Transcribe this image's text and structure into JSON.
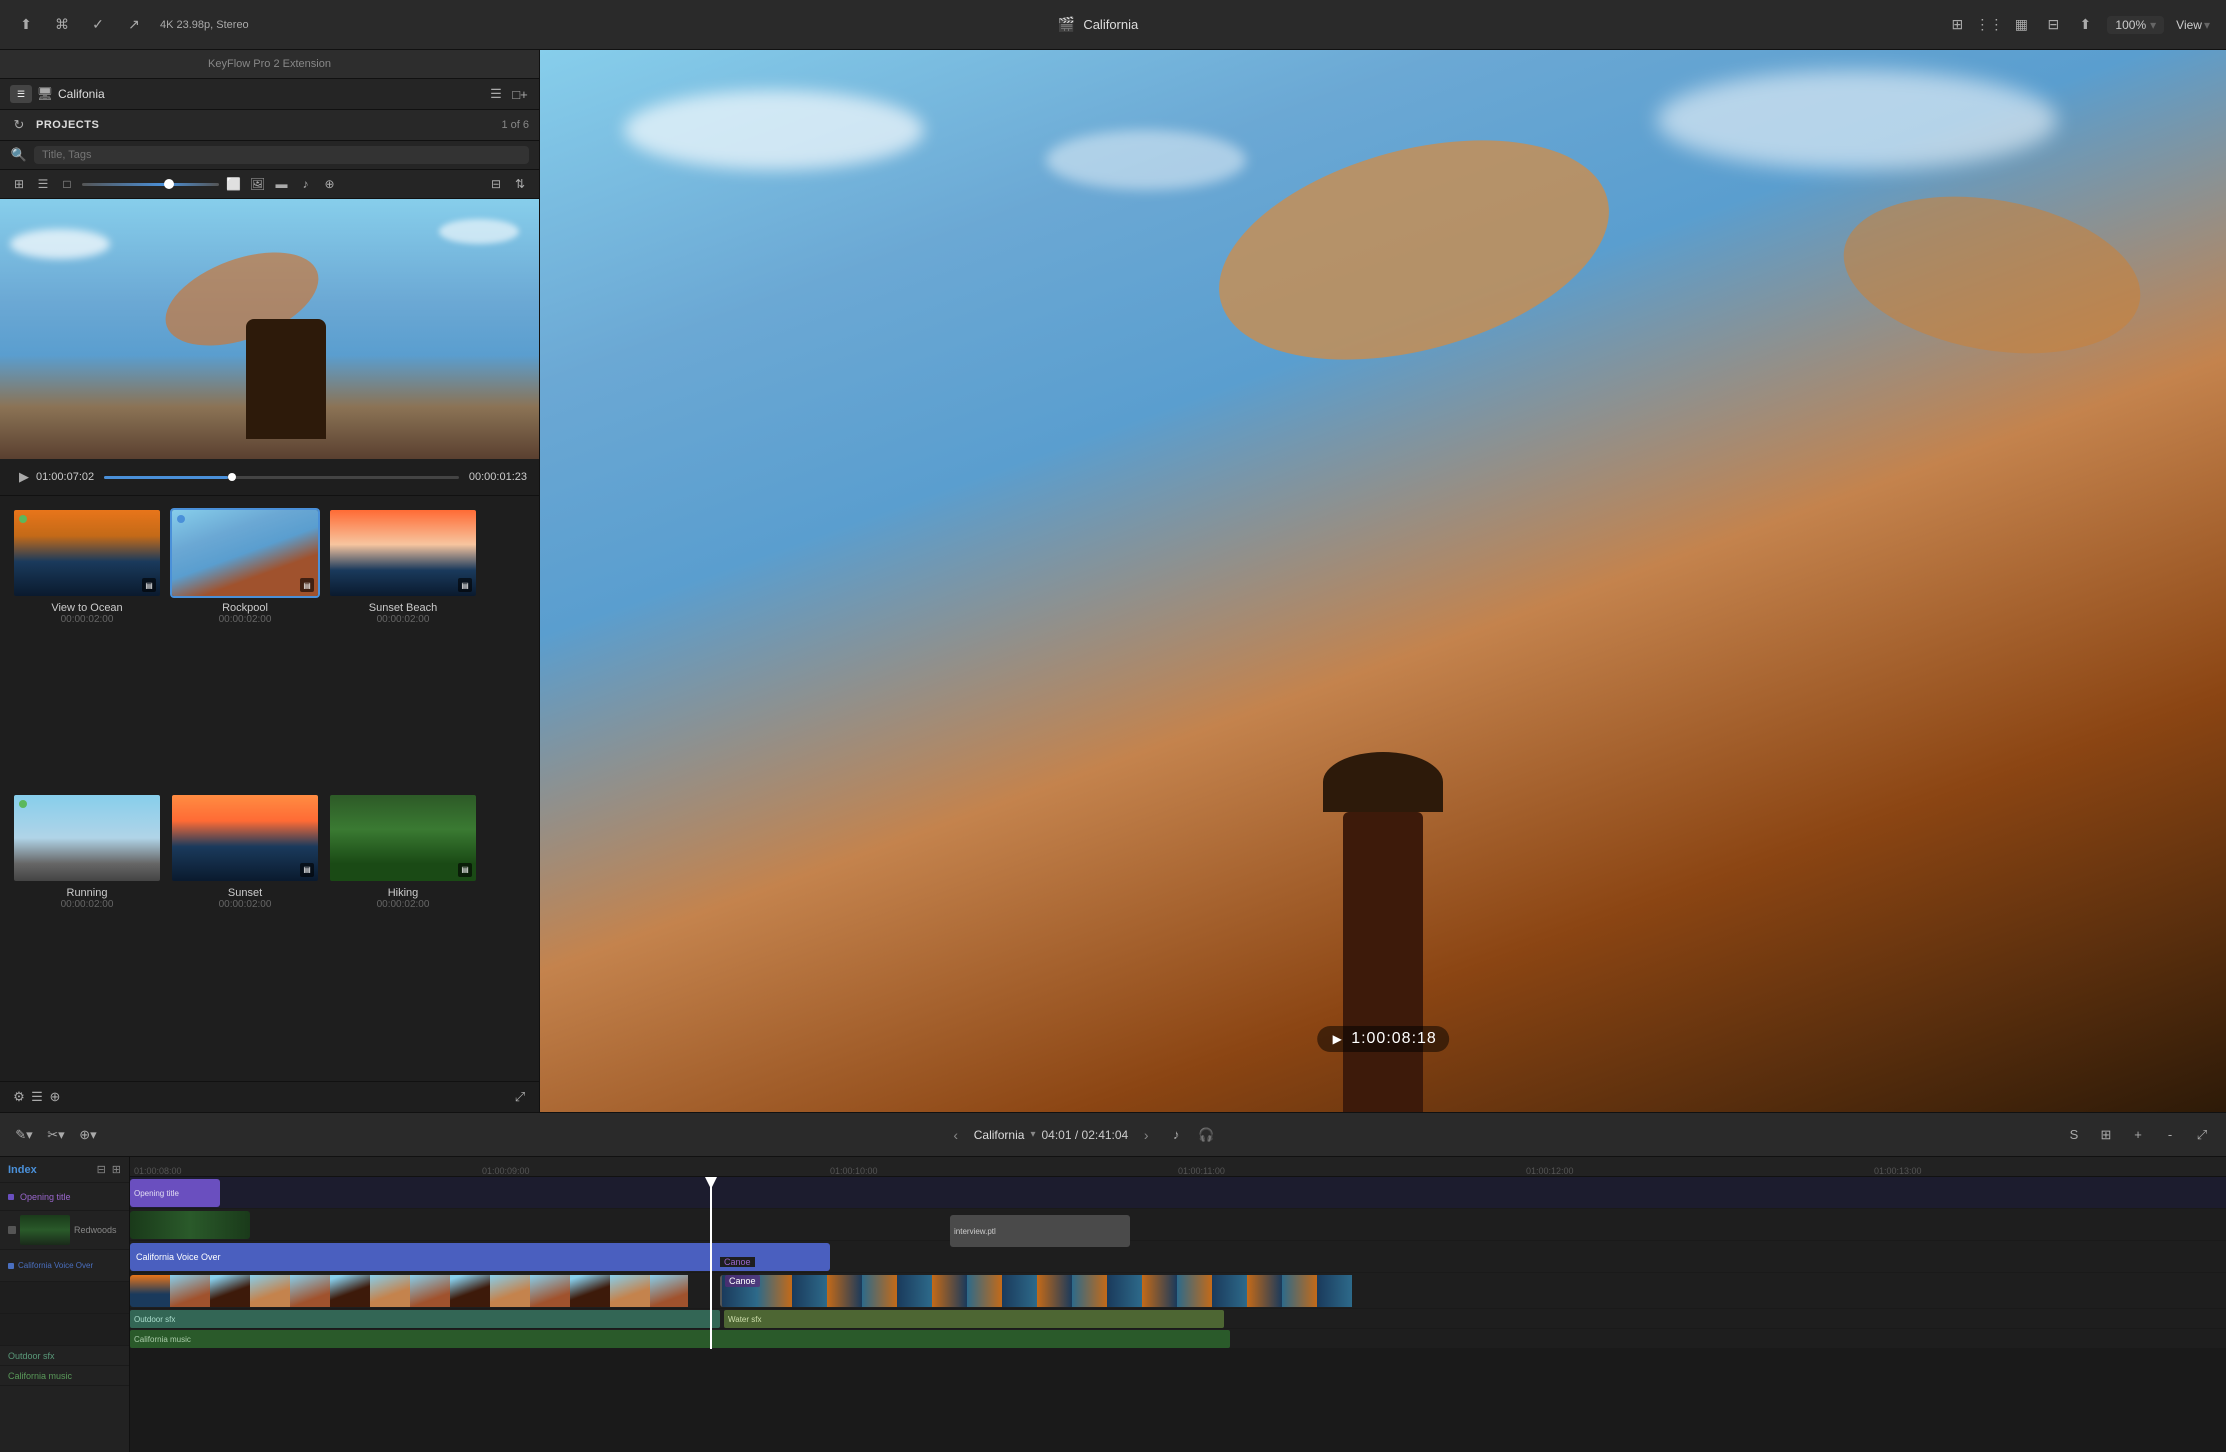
{
  "app": {
    "title": "California",
    "resolution": "4K 23.98p, Stereo",
    "zoom": "100%",
    "view_label": "View"
  },
  "toolbar": {
    "icons": [
      "arrow-up-icon",
      "key-icon",
      "check-icon",
      "share-icon"
    ],
    "right_icons": [
      "browser-icon",
      "grid-icon",
      "editor-icon",
      "settings-icon",
      "export-icon"
    ]
  },
  "keyflow": {
    "title": "KeyFlow Pro 2 Extension",
    "monitor_label": "Califonia",
    "projects_label": "PROJECTS",
    "projects_count": "1 of 6",
    "search_placeholder": "Title, Tags",
    "preview_timecode_left": "01:00:07:02",
    "preview_timecode_right": "00:00:01:23",
    "clips": [
      {
        "name": "View to Ocean",
        "duration": "00:00:02:00",
        "bg": "bg-ocean",
        "dot": "green",
        "badge": "▤"
      },
      {
        "name": "Rockpool",
        "duration": "00:00:02:00",
        "bg": "bg-rockpool",
        "dot": "blue",
        "badge": "▤",
        "selected": true
      },
      {
        "name": "Sunset Beach",
        "duration": "00:00:02:00",
        "bg": "bg-sunset",
        "dot": "",
        "badge": "▤"
      },
      {
        "name": "Running",
        "duration": "00:00:02:00",
        "bg": "bg-running",
        "dot": "green",
        "badge": ""
      },
      {
        "name": "Sunset",
        "duration": "00:00:02:00",
        "bg": "bg-sunset2",
        "dot": "",
        "badge": "▤"
      },
      {
        "name": "Hiking",
        "duration": "00:00:02:00",
        "bg": "bg-hiking",
        "dot": "",
        "badge": "▤"
      }
    ],
    "bottom_icons": [
      "settings-icon",
      "list-icon",
      "share-icon",
      "expand-icon"
    ]
  },
  "main_preview": {
    "timecode": "1:00:08:18"
  },
  "timeline": {
    "sequence_name": "California",
    "timecode": "04:01 / 02:41:04",
    "ruler_marks": [
      "01:00:08:00",
      "01:00:09:00",
      "01:00:10:00",
      "01:00:11:00",
      "01:00:12:00",
      "01:00:13:00"
    ],
    "tracks": [
      {
        "label": "Opening title",
        "color": "#6a4fbf",
        "type": "title"
      },
      {
        "label": "Redwoods",
        "color": "#444",
        "type": "video"
      },
      {
        "label": "California Voice Over",
        "color": "#4a6fbf",
        "type": "audio"
      },
      {
        "label": "Outdoor sfx",
        "color": "#336655",
        "type": "audio"
      },
      {
        "label": "California music",
        "color": "#2a5a2a",
        "type": "audio"
      }
    ],
    "clips": {
      "canoe_label": "Canoe",
      "canoe2_label": "Canoe",
      "interview_label": "interview.ptl",
      "water_sfx_label": "Water sfx"
    }
  },
  "index": {
    "tab_label": "Index",
    "items": [
      {
        "label": "Opening title",
        "color": "#6a4fbf"
      },
      {
        "label": "Redwoods",
        "color": "#555"
      },
      {
        "label": "California Voice Over",
        "color": "#4a6fbf"
      }
    ]
  }
}
